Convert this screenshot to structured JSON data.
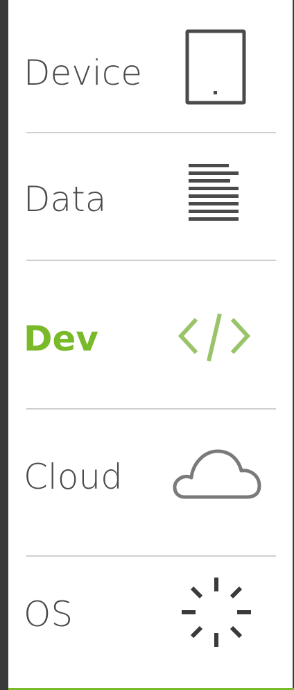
{
  "menu": {
    "items": [
      {
        "label": "Device",
        "icon": "tablet-icon",
        "active": false
      },
      {
        "label": "Data",
        "icon": "text-lines-icon",
        "active": false
      },
      {
        "label": "Dev",
        "icon": "code-icon",
        "active": true
      },
      {
        "label": "Cloud",
        "icon": "cloud-icon",
        "active": false
      },
      {
        "label": "OS",
        "icon": "loading-spinner-icon",
        "active": false
      }
    ]
  },
  "colors": {
    "accent": "#7ab929",
    "text": "#4a4a4a",
    "sidebar": "#3a3a3a",
    "divider": "#cfcfcf",
    "icon_inactive": "#555555",
    "icon_light": "#7a7a7a"
  }
}
